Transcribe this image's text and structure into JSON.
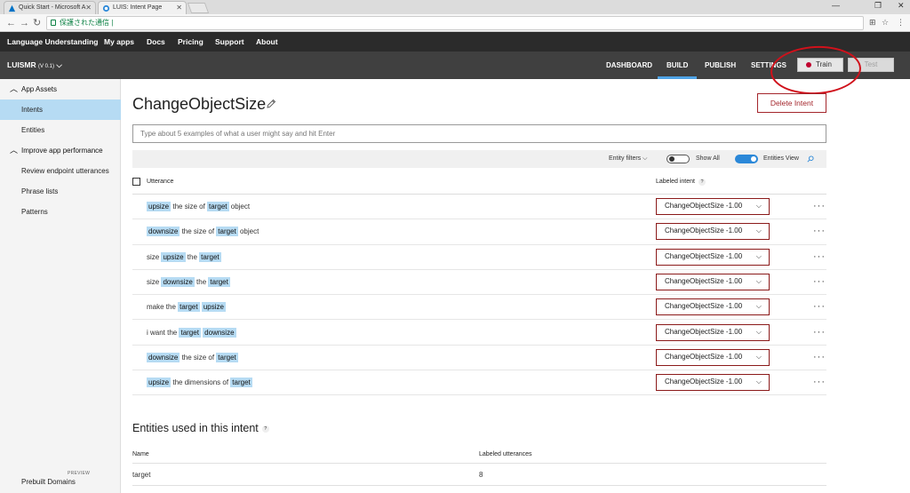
{
  "browser": {
    "tabs": [
      {
        "title": "Quick Start - Microsoft A"
      },
      {
        "title": "LUIS: Intent Page"
      }
    ],
    "address": "保護された通信 |",
    "window_controls": {
      "min": "—",
      "max": "❐",
      "close": "✕"
    }
  },
  "topnav": {
    "brand": "Language Understanding",
    "items": [
      "My apps",
      "Docs",
      "Pricing",
      "Support",
      "About"
    ]
  },
  "subnav": {
    "app_name": "LUISMR",
    "version": "(V 0.1)",
    "tabs": [
      "DASHBOARD",
      "BUILD",
      "PUBLISH",
      "SETTINGS"
    ],
    "active_tab": "BUILD",
    "train_label": "Train",
    "test_label": "Test"
  },
  "sidebar": {
    "app_assets": "App Assets",
    "intents": "Intents",
    "entities": "Entities",
    "improve": "Improve app performance",
    "review": "Review endpoint utterances",
    "phrase_lists": "Phrase lists",
    "patterns": "Patterns",
    "prebuilt": "Prebuilt Domains",
    "preview": "PREVIEW"
  },
  "main": {
    "title": "ChangeObjectSize",
    "delete_label": "Delete Intent",
    "input_placeholder": "Type about 5 examples of what a user might say and hit Enter",
    "entity_filters": "Entity filters",
    "show_all": "Show All",
    "entities_view": "Entities View",
    "col_utterance": "Utterance",
    "col_labeled_intent": "Labeled intent",
    "utterances": [
      {
        "parts": [
          {
            "t": "upsize",
            "e": true
          },
          {
            "t": " the size of ",
            "e": false
          },
          {
            "t": "target",
            "e": true
          },
          {
            "t": " object",
            "e": false
          }
        ],
        "intent": "ChangeObjectSize -1.00"
      },
      {
        "parts": [
          {
            "t": "downsize",
            "e": true
          },
          {
            "t": " the size of ",
            "e": false
          },
          {
            "t": "target",
            "e": true
          },
          {
            "t": " object",
            "e": false
          }
        ],
        "intent": "ChangeObjectSize -1.00"
      },
      {
        "parts": [
          {
            "t": "size ",
            "e": false
          },
          {
            "t": "upsize",
            "e": true
          },
          {
            "t": " the ",
            "e": false
          },
          {
            "t": "target",
            "e": true
          }
        ],
        "intent": "ChangeObjectSize -1.00"
      },
      {
        "parts": [
          {
            "t": "size ",
            "e": false
          },
          {
            "t": "downsize",
            "e": true
          },
          {
            "t": " the ",
            "e": false
          },
          {
            "t": "target",
            "e": true
          }
        ],
        "intent": "ChangeObjectSize -1.00"
      },
      {
        "parts": [
          {
            "t": "make the ",
            "e": false
          },
          {
            "t": "target",
            "e": true
          },
          {
            "t": " ",
            "e": false
          },
          {
            "t": "upsize",
            "e": true
          }
        ],
        "intent": "ChangeObjectSize -1.00"
      },
      {
        "parts": [
          {
            "t": "i want the ",
            "e": false
          },
          {
            "t": "target",
            "e": true
          },
          {
            "t": " ",
            "e": false
          },
          {
            "t": "downsize",
            "e": true
          }
        ],
        "intent": "ChangeObjectSize -1.00"
      },
      {
        "parts": [
          {
            "t": "downsize",
            "e": true
          },
          {
            "t": " the size of ",
            "e": false
          },
          {
            "t": "target",
            "e": true
          }
        ],
        "intent": "ChangeObjectSize -1.00"
      },
      {
        "parts": [
          {
            "t": "upsize",
            "e": true
          },
          {
            "t": " the dimensions of ",
            "e": false
          },
          {
            "t": "target",
            "e": true
          }
        ],
        "intent": "ChangeObjectSize -1.00"
      }
    ],
    "entities_title": "Entities used in this intent",
    "ent_col_name": "Name",
    "ent_col_labeled": "Labeled utterances",
    "entities_rows": [
      {
        "name": "target",
        "count": "8"
      }
    ]
  },
  "colors": {
    "accent": "#4fa3e6",
    "entity_highlight": "#b6dbf3",
    "delete": "#a4262c",
    "annotation_circle": "#d0111b"
  }
}
